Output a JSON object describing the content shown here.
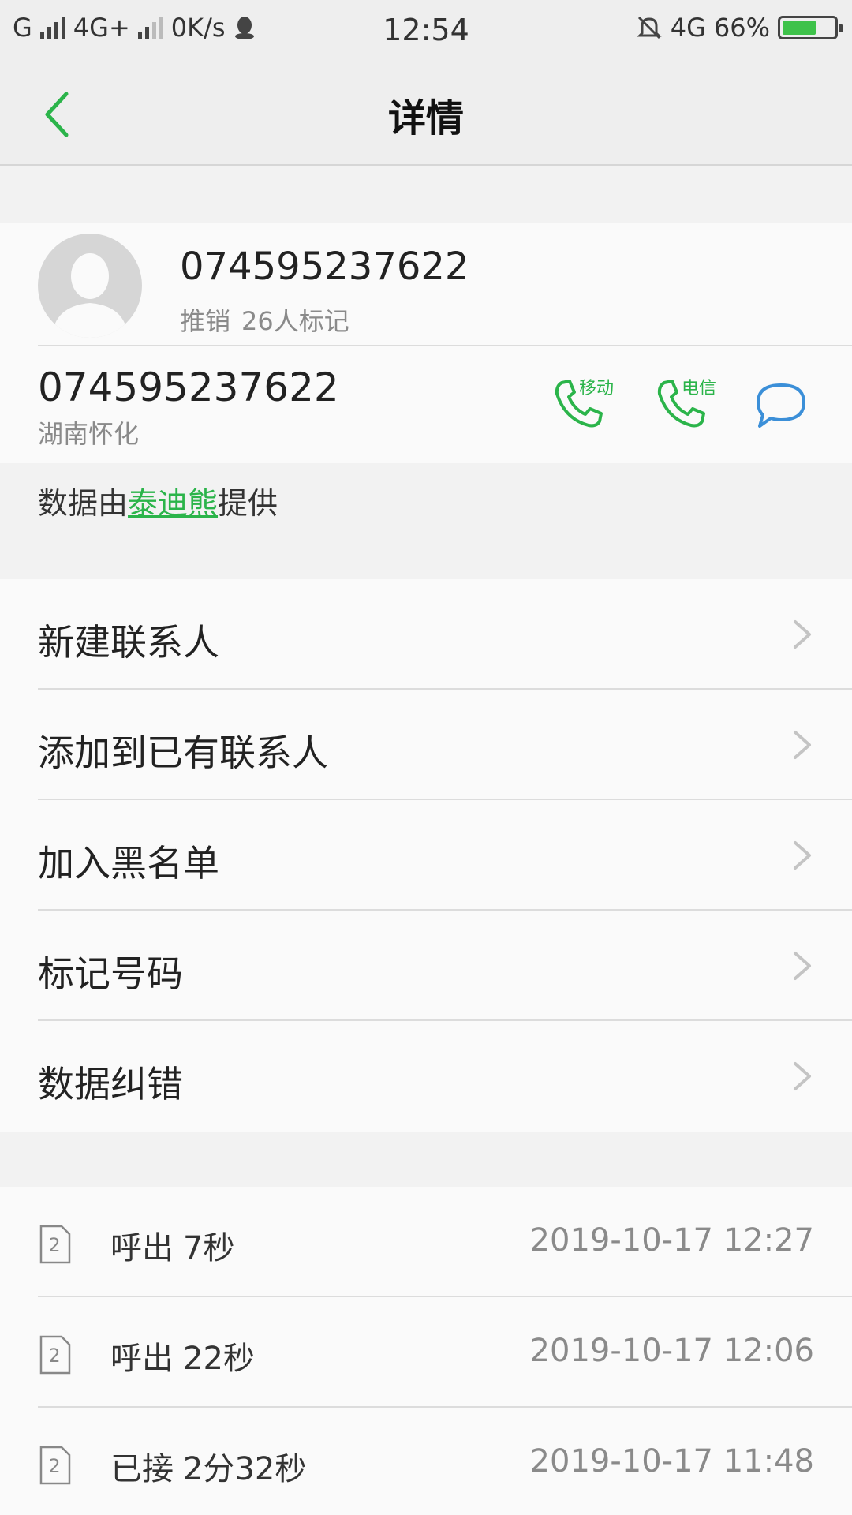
{
  "status_bar": {
    "network_1": "G",
    "network_2": "4G+",
    "speed": "0K/s",
    "time": "12:54",
    "network_3": "4G",
    "battery_percent": "66%",
    "battery_level": 0.66
  },
  "header": {
    "title": "详情"
  },
  "contact": {
    "name": "074595237622",
    "tag": "推销",
    "mark_count": "26人标记",
    "number": "074595237622",
    "location": "湖南怀化",
    "call_mobile_label": "移动",
    "call_telecom_label": "电信"
  },
  "provider": {
    "prefix": "数据由",
    "link": "泰迪熊",
    "suffix": "提供"
  },
  "actions": [
    {
      "label": "新建联系人"
    },
    {
      "label": "添加到已有联系人"
    },
    {
      "label": "加入黑名单"
    },
    {
      "label": "标记号码"
    },
    {
      "label": "数据纠错"
    }
  ],
  "call_log": [
    {
      "sim": "2",
      "type": "呼出",
      "duration": "7秒",
      "time": "2019-10-17 12:27"
    },
    {
      "sim": "2",
      "type": "呼出",
      "duration": "22秒",
      "time": "2019-10-17 12:06"
    },
    {
      "sim": "2",
      "type": "已接",
      "duration": "2分32秒",
      "time": "2019-10-17 11:48"
    }
  ],
  "colors": {
    "accent": "#2bb44a",
    "sms": "#3b8fd8"
  }
}
